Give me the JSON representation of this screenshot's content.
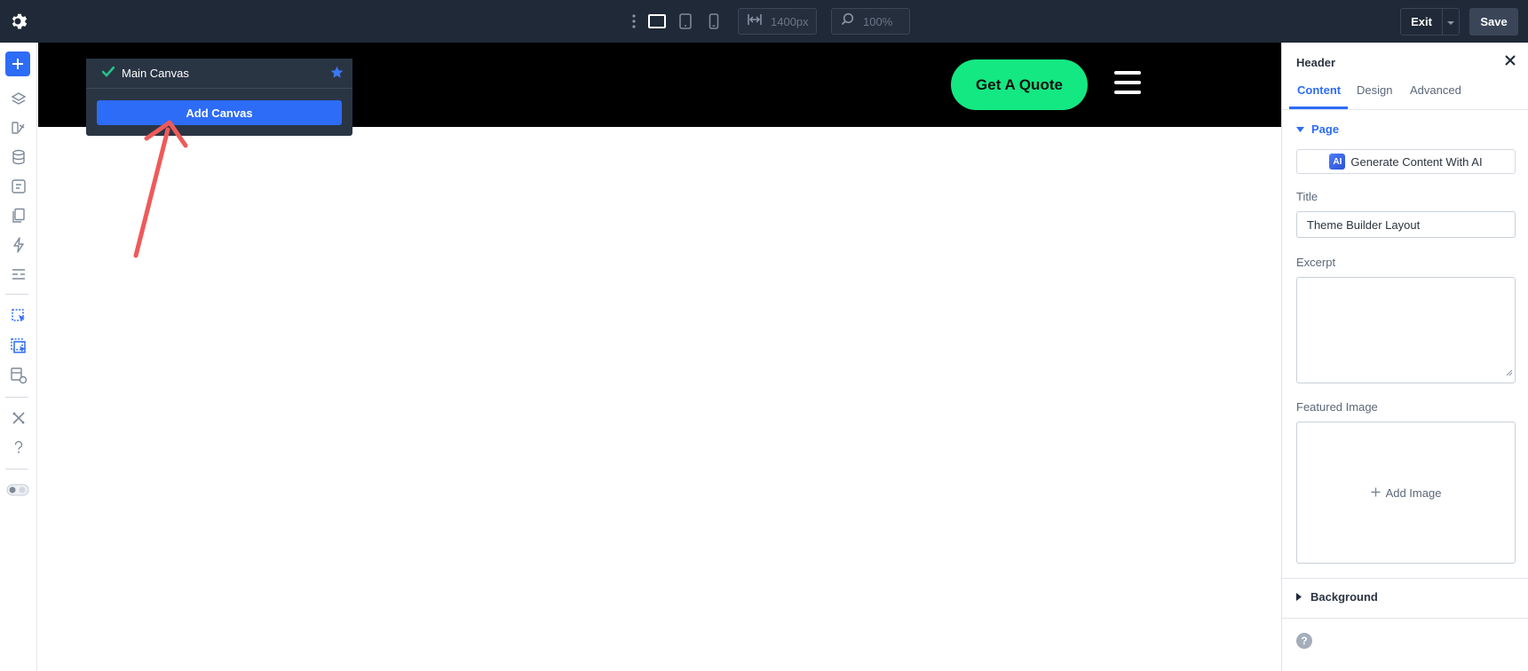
{
  "topbar": {
    "width_value": "1400px",
    "zoom_value": "100%",
    "exit_label": "Exit",
    "save_label": "Save",
    "icons": [
      "gear-icon",
      "more-vertical-icon",
      "desktop-icon",
      "tablet-icon",
      "phone-icon",
      "width-icon",
      "zoom-icon",
      "chevron-down-icon"
    ]
  },
  "rail": {
    "icons": [
      "plus-icon",
      "layers-icon",
      "theme-icon",
      "database-icon",
      "portability-icon",
      "pages-icon",
      "bolt-icon",
      "presets-icon",
      "page-canvas-icon",
      "canvas-list-icon",
      "builder-settings-icon",
      "tools-icon",
      "help-icon",
      "toggle-icon"
    ]
  },
  "canvas_menu": {
    "current_canvas": "Main Canvas",
    "add_label": "Add Canvas"
  },
  "site_header": {
    "cta_label": "Get A Quote",
    "cta_color": "#14e883"
  },
  "panel": {
    "title": "Header",
    "tabs": [
      {
        "label": "Content"
      },
      {
        "label": "Design"
      },
      {
        "label": "Advanced"
      }
    ],
    "section_page": "Page",
    "ai_button": "Generate Content With AI",
    "ai_badge": "AI",
    "title_label": "Title",
    "title_value": "Theme Builder Layout",
    "excerpt_label": "Excerpt",
    "featured_label": "Featured Image",
    "add_image": "Add Image",
    "section_background": "Background",
    "help": "?"
  },
  "colors": {
    "accent": "#2d6cf6",
    "topbar": "#1f2937",
    "annotation_arrow": "#ef5a5a"
  }
}
